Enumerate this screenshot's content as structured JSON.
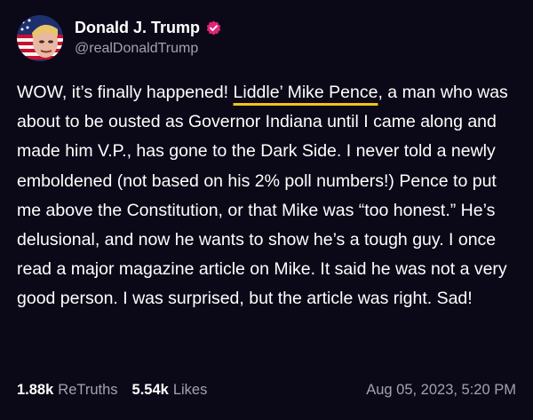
{
  "author": {
    "display_name": "Donald J. Trump",
    "handle": "@realDonaldTrump",
    "verified": true,
    "verified_color": "#e0247a"
  },
  "post": {
    "text_before": "WOW, it’s finally happened! ",
    "mention": "Liddle’ Mike Pence",
    "text_after": ", a man who was about to be ousted as Governor Indiana until I came along and made him V.P., has gone to the Dark Side. I never told a newly emboldened (not based on his 2% poll numbers!) Pence to put me above the Constitution, or that Mike was “too honest.” He’s delusional, and now he wants to show he’s a tough guy. I once read a major magazine article on Mike. It said he was not a very good person. I was surprised, but the article was right. Sad!",
    "mention_underline_color": "#f2c21b"
  },
  "stats": {
    "retruths_value": "1.88k",
    "retruths_label": "ReTruths",
    "likes_value": "5.54k",
    "likes_label": "Likes"
  },
  "timestamp": "Aug 05, 2023, 5:20 PM",
  "colors": {
    "background": "#0b0917",
    "text": "#ffffff",
    "muted": "#a3a1b0"
  }
}
